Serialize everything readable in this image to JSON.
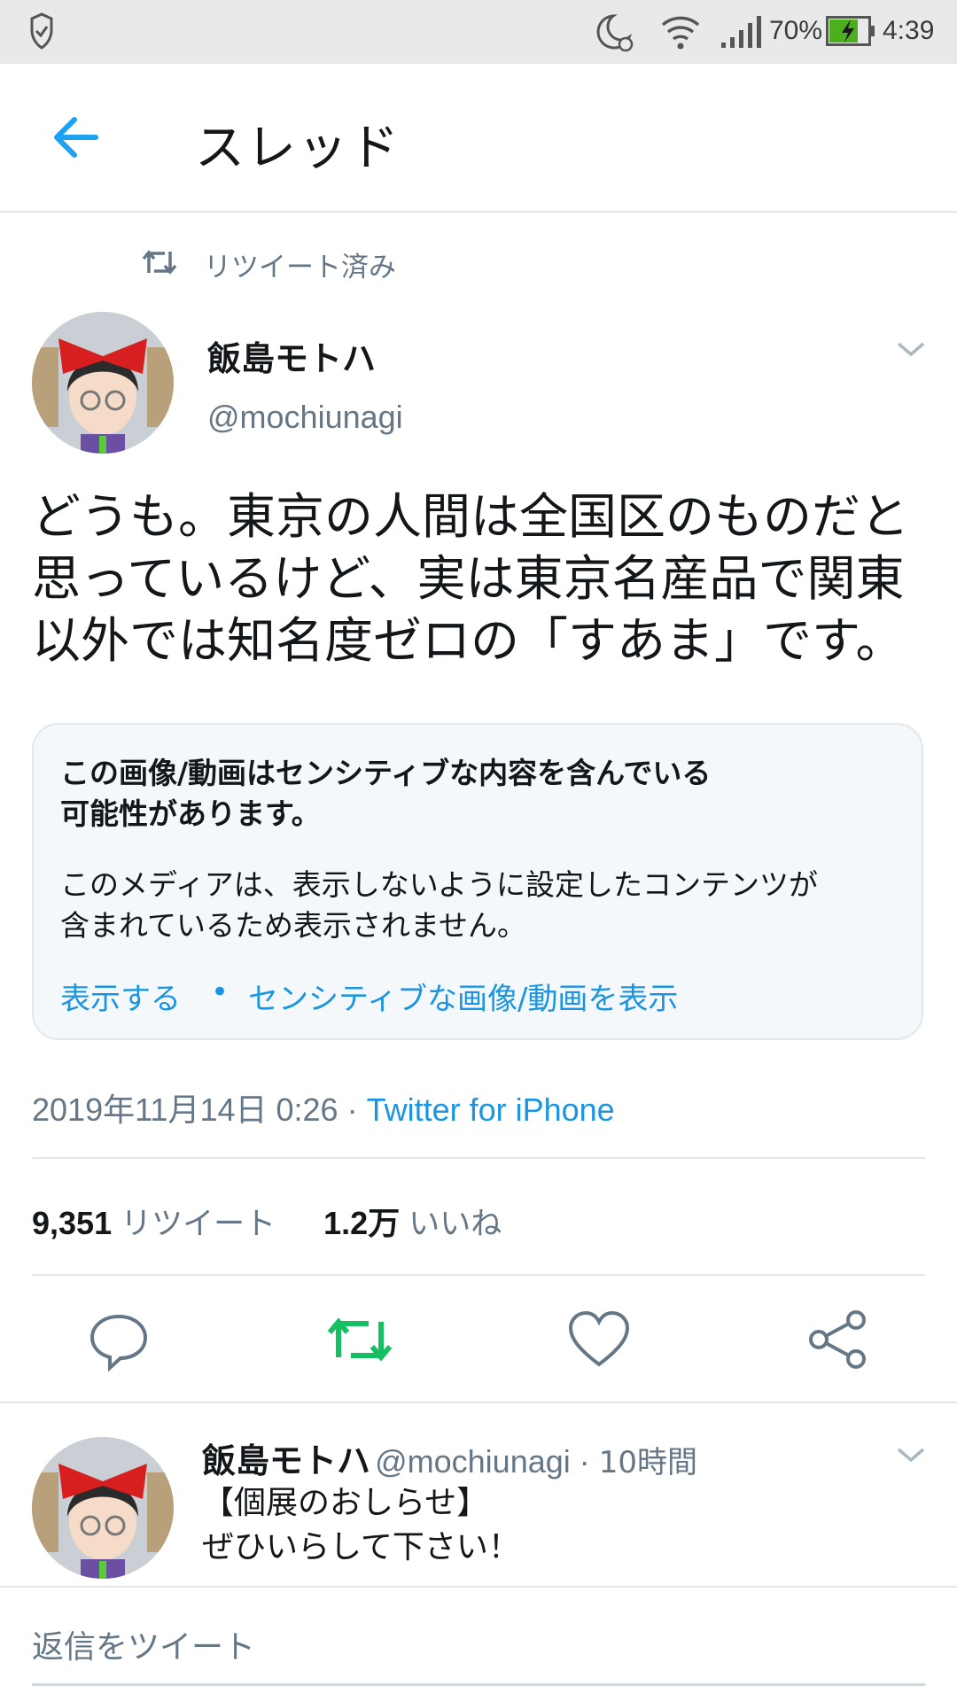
{
  "status_bar": {
    "battery_percent": "70%",
    "time": "4:39"
  },
  "header": {
    "title": "スレッド"
  },
  "tweet": {
    "retweet_label": "リツイート済み",
    "author_name": "飯島モトハ",
    "author_handle": "@mochiunagi",
    "text_lines": [
      "どうも。東京の人間は全国区のものだと",
      "思っているけど、実は東京名産品で関東",
      "以外では知名度ゼロの「すあま」です。"
    ],
    "sensitive": {
      "title_lines": [
        "この画像/動画はセンシティブな内容を含んでいる",
        "可能性があります。"
      ],
      "body_lines": [
        "このメディアは、表示しないように設定したコンテンツが",
        "含まれているため表示されません。"
      ],
      "show_link": "表示する",
      "separator": "•",
      "settings_link": "センシティブな画像/動画を表示"
    },
    "timestamp": "2019年11月14日 0:26",
    "meta_separator": " · ",
    "source": "Twitter for iPhone",
    "retweet_count": "9,351",
    "retweet_count_label": "リツイート",
    "like_count": "1.2万",
    "like_count_label": "いいね",
    "colors": {
      "retweet_active": "#17bf63",
      "link": "#1b95e0",
      "muted": "#657786"
    }
  },
  "reply": {
    "author_name": "飯島モトハ",
    "author_handle": "@mochiunagi",
    "time_sep": " · ",
    "time_ago": "10時間",
    "text_lines": [
      "【個展のおしらせ】",
      "ぜひいらして下さい！"
    ]
  },
  "compose": {
    "placeholder": "返信をツイート"
  }
}
